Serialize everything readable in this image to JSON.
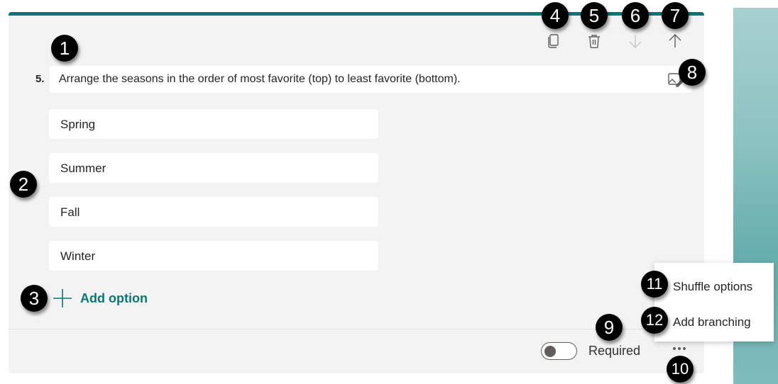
{
  "question": {
    "number": "5.",
    "title": "Arrange the seasons in the order of most favorite (top) to least favorite (bottom)."
  },
  "options": [
    {
      "label": "Spring"
    },
    {
      "label": "Summer"
    },
    {
      "label": "Fall"
    },
    {
      "label": "Winter"
    }
  ],
  "toolbar": {
    "copy_icon": "copy-icon",
    "delete_icon": "trash-icon",
    "move_down_icon": "arrow-down-icon",
    "move_up_icon": "arrow-up-icon",
    "move_down_disabled": true
  },
  "add_option_label": "Add option",
  "footer": {
    "required_label": "Required",
    "required_on": false,
    "more_icon": "ellipsis-icon"
  },
  "menu": {
    "items": [
      {
        "label": "Shuffle options"
      },
      {
        "label": "Add branching"
      }
    ]
  },
  "callouts": [
    "1",
    "2",
    "3",
    "4",
    "5",
    "6",
    "7",
    "8",
    "9",
    "10",
    "11",
    "12"
  ],
  "colors": {
    "accent": "#077775",
    "card_bg": "#f3f3f3",
    "side_panel": "#67aeae"
  }
}
